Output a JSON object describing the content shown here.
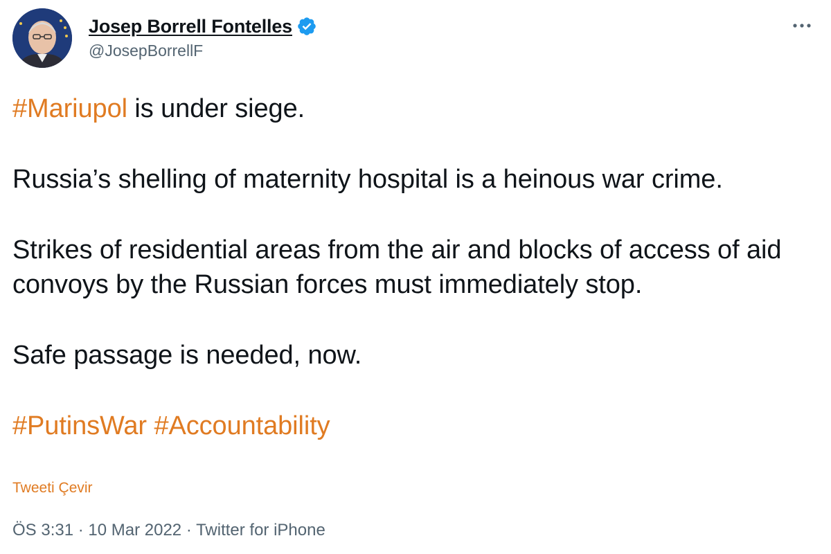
{
  "author": {
    "display_name": "Josep Borrell Fontelles",
    "handle": "@JosepBorrellF",
    "verified_icon": "verified-badge-icon"
  },
  "tweet": {
    "p1": {
      "hashtag": "#Mariupol",
      "text": " is under siege."
    },
    "p2": "Russia’s shelling of maternity hospital is a heinous war crime.",
    "p3": "Strikes of residential areas from the air and blocks of access of aid convoys by the Russian forces must immediately stop.",
    "p4": "Safe passage is needed, now.",
    "hashtags": [
      "#PutinsWar",
      "#Accountability"
    ]
  },
  "translate_label": "Tweeti Çevir",
  "meta": {
    "time": "ÖS 3:31",
    "separator": " · ",
    "date": "10 Mar 2022",
    "source": "Twitter for iPhone"
  },
  "colors": {
    "accent": "#e07b22",
    "text": "#0f1419",
    "muted": "#536471",
    "verified": "#1d9bf0"
  }
}
